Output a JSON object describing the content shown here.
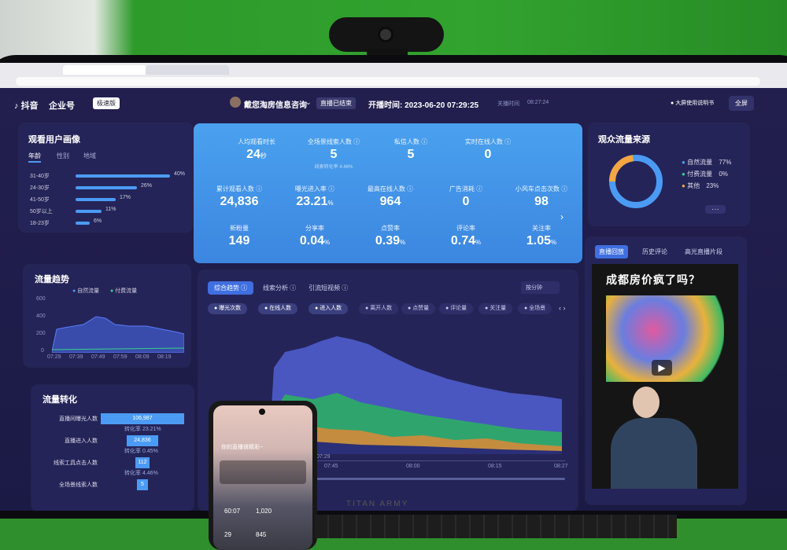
{
  "header": {
    "app_name": "抖音",
    "brand": "企业号",
    "badge": "极速版",
    "streamer": "戴您淘房信息咨询",
    "status": "直播已结束",
    "start_time": "开播时间: 2023-06-20 07:29:25",
    "end_label": "关播时间",
    "end_time": "08:27:24",
    "manual": "大屏使用说明书",
    "fullscreen": "全屏"
  },
  "monitor_brand": "TITAN ARMY",
  "audience": {
    "title": "观看用户画像",
    "tabs": [
      "年龄",
      "性别",
      "地域"
    ],
    "bars": [
      {
        "label": "31-40岁",
        "pct": "40%",
        "value": 40
      },
      {
        "label": "24-30岁",
        "pct": "26%",
        "value": 26
      },
      {
        "label": "41-50岁",
        "pct": "17%",
        "value": 17
      },
      {
        "label": "50岁以上",
        "pct": "11%",
        "value": 11
      },
      {
        "label": "18-23岁",
        "pct": "6%",
        "value": 6
      }
    ]
  },
  "traffic_trend": {
    "title": "流量趋势",
    "legend_natural": "自然流量",
    "legend_paid": "付费流量",
    "y_ticks": [
      "600",
      "400",
      "200",
      "0"
    ],
    "x_ticks": [
      "07:29",
      "07:39",
      "07:49",
      "07:59",
      "08:09",
      "08:19"
    ]
  },
  "conversion": {
    "title": "流量转化",
    "rows": [
      {
        "label": "直播间曝光人数",
        "value": "106,987",
        "rate": "转化率 23.21%"
      },
      {
        "label": "直播进入人数",
        "value": "24,836",
        "rate": "转化率 0.45%"
      },
      {
        "label": "线索工具点击人数",
        "value": "112",
        "rate": "转化率 4.46%"
      },
      {
        "label": "全场景线索人数",
        "value": "5",
        "rate": ""
      }
    ]
  },
  "metrics": [
    {
      "label": "人均观看时长",
      "value": "24",
      "unit": "秒",
      "sub": ""
    },
    {
      "label": "全场景线索人数 ⓘ",
      "value": "5",
      "unit": "",
      "sub": "线索转化率 4.46%"
    },
    {
      "label": "私信人数 ⓘ",
      "value": "5",
      "unit": "",
      "sub": ""
    },
    {
      "label": "实时在线人数 ⓘ",
      "value": "0",
      "unit": "",
      "sub": ""
    },
    {
      "label": "累计观看人数 ⓘ",
      "value": "24,836",
      "unit": "",
      "sub": ""
    },
    {
      "label": "曝光进入率 ⓘ",
      "value": "23.21",
      "unit": "%",
      "sub": ""
    },
    {
      "label": "最高在线人数 ⓘ",
      "value": "964",
      "unit": "",
      "sub": ""
    },
    {
      "label": "广告消耗 ⓘ",
      "value": "0",
      "unit": "",
      "sub": ""
    },
    {
      "label": "小风车点击次数 ⓘ",
      "value": "98",
      "unit": "",
      "sub": ""
    },
    {
      "label": "新粉量",
      "value": "149",
      "unit": "",
      "sub": ""
    },
    {
      "label": "分享率",
      "value": "0.04",
      "unit": "%",
      "sub": ""
    },
    {
      "label": "点赞率",
      "value": "0.39",
      "unit": "%",
      "sub": ""
    },
    {
      "label": "评论率",
      "value": "0.74",
      "unit": "%",
      "sub": ""
    },
    {
      "label": "关注率",
      "value": "1.05",
      "unit": "%",
      "sub": ""
    }
  ],
  "trend": {
    "tabs": [
      "综合趋势 ⓘ",
      "线索分析 ⓘ",
      "引流短视频 ⓘ"
    ],
    "period": "按分钟",
    "chips": [
      "曝光次数",
      "在线人数",
      "进入人数",
      "离开人数",
      "点赞量",
      "评论量",
      "关注量",
      "全场景"
    ],
    "x_ticks": [
      "07:29",
      "07:45",
      "08:00",
      "08:15",
      "08:27"
    ]
  },
  "sources": {
    "title": "观众流量来源",
    "items": [
      {
        "label": "自然流量",
        "pct": "77%",
        "color": "#4b9bf5",
        "value": 77
      },
      {
        "label": "付费流量",
        "pct": "0%",
        "color": "#37d28a",
        "value": 0
      },
      {
        "label": "其他",
        "pct": "23%",
        "color": "#f5a640",
        "value": 23
      }
    ],
    "more": "···"
  },
  "replay": {
    "tabs": [
      "直播回放",
      "历史评论",
      "高光直播片段"
    ],
    "video_title": "成都房价疯了吗？"
  },
  "phone": {
    "title": "你的直播很精彩~",
    "stats": [
      "60:07",
      "1,020",
      "29",
      "845"
    ]
  }
}
